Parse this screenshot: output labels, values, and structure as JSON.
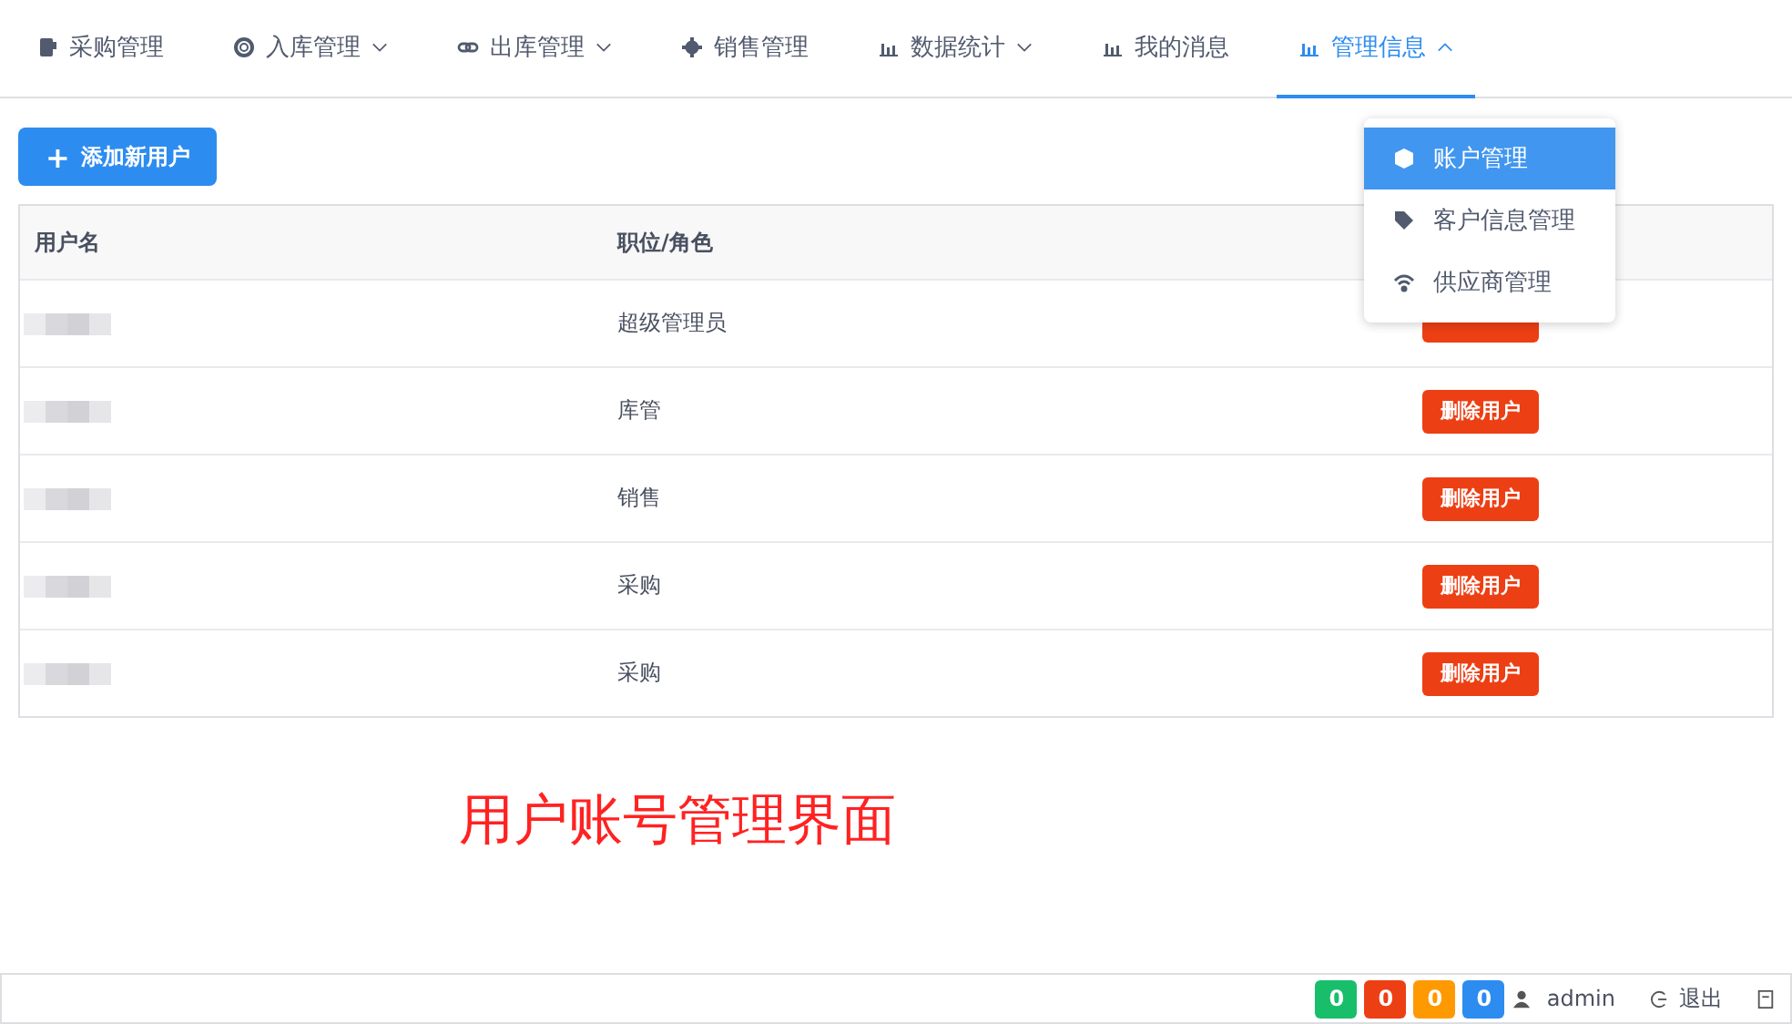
{
  "nav": [
    {
      "label": "采购管理",
      "kind": "link",
      "selected": false
    },
    {
      "label": "入库管理",
      "kind": "submenu",
      "expanded": false,
      "selected": false
    },
    {
      "label": "出库管理",
      "kind": "submenu",
      "expanded": false,
      "selected": false
    },
    {
      "label": "销售管理",
      "kind": "link",
      "selected": false
    },
    {
      "label": "数据统计",
      "kind": "submenu",
      "expanded": false,
      "selected": false
    },
    {
      "label": "我的消息",
      "kind": "link",
      "selected": false
    },
    {
      "label": "管理信息",
      "kind": "submenu",
      "expanded": true,
      "selected": true
    }
  ],
  "dropdown": [
    {
      "label": "账户管理",
      "selected": true
    },
    {
      "label": "客户信息管理",
      "selected": false
    },
    {
      "label": "供应商管理",
      "selected": false
    }
  ],
  "add_button": {
    "icon": "+",
    "label": "添加新用户"
  },
  "table": {
    "columns": [
      "用户名",
      "职位/角色"
    ],
    "rows": [
      {
        "role": "超级管理员"
      },
      {
        "role": "库管",
        "action": "删除用户"
      },
      {
        "role": "销售",
        "action": "删除用户"
      },
      {
        "role": "采购",
        "action": "删除用户"
      },
      {
        "role": "采购",
        "action": "删除用户"
      }
    ]
  },
  "caption": "用户账号管理界面",
  "status_bar": {
    "counters": [
      {
        "value": "0",
        "color": "#19be6b"
      },
      {
        "value": "0",
        "color": "#ed3f14"
      },
      {
        "value": "0",
        "color": "#ff9900"
      },
      {
        "value": "0",
        "color": "#2d8cf0"
      }
    ],
    "user": "admin",
    "logout": "退出"
  }
}
